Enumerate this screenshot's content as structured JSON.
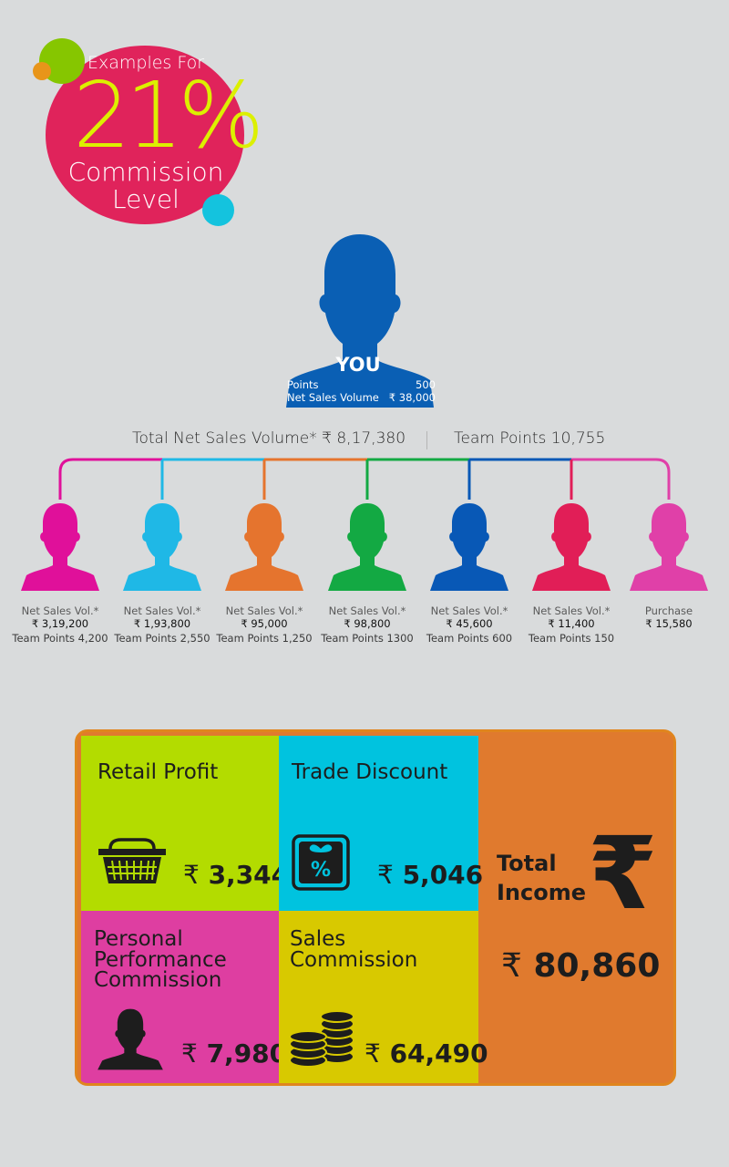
{
  "badge": {
    "examples_for": "Examples For",
    "percent": "21%",
    "line1": "Commission",
    "line2": "Level"
  },
  "you": {
    "label": "YOU",
    "points_label": "Points",
    "points_value": "500",
    "net_sales_label": "Net Sales  Volume",
    "net_sales_value": "₹ 38,000"
  },
  "totals": {
    "net_sales": "Total Net Sales Volume* ₹ 8,17,380",
    "team_points": "Team Points 10,755"
  },
  "members": [
    {
      "color": "#e0109a",
      "line1": "Net Sales Vol.*",
      "line2": "₹ 3,19,200",
      "line3": "Team Points 4,200"
    },
    {
      "color": "#1fb8e6",
      "line1": "Net Sales Vol.*",
      "line2": "₹ 1,93,800",
      "line3": "Team Points 2,550"
    },
    {
      "color": "#e5742e",
      "line1": "Net Sales Vol.*",
      "line2": "₹ 95,000",
      "line3": "Team Points 1,250"
    },
    {
      "color": "#13a943",
      "line1": "Net Sales Vol.*",
      "line2": "₹ 98,800",
      "line3": "Team Points 1300"
    },
    {
      "color": "#0858b6",
      "line1": "Net Sales Vol.*",
      "line2": "₹ 45,600",
      "line3": "Team Points 600"
    },
    {
      "color": "#e11e57",
      "line1": "Net Sales Vol.*",
      "line2": "₹ 11,400",
      "line3": "Team Points 150"
    },
    {
      "color": "#e040a8",
      "line1": "Purchase",
      "line2": "₹ 15,580",
      "line3": ""
    }
  ],
  "income": {
    "retail_profit": {
      "title": "Retail Profit",
      "amount": "3,344",
      "icon": "basket-icon"
    },
    "trade_discount": {
      "title": "Trade Discount",
      "amount": "5,046",
      "icon": "discount-gift-icon"
    },
    "personal_performance": {
      "title_l1": "Personal",
      "title_l2": "Performance",
      "title_l3": "Commission",
      "amount": "7,980",
      "icon": "person-icon"
    },
    "sales_commission": {
      "title": "Sales Commission",
      "amount": "64,490",
      "icon": "coins-icon"
    },
    "total": {
      "title_l1": "Total",
      "title_l2": "Income",
      "amount": "80,860",
      "icon": "rupee-icon"
    },
    "currency": "₹"
  }
}
